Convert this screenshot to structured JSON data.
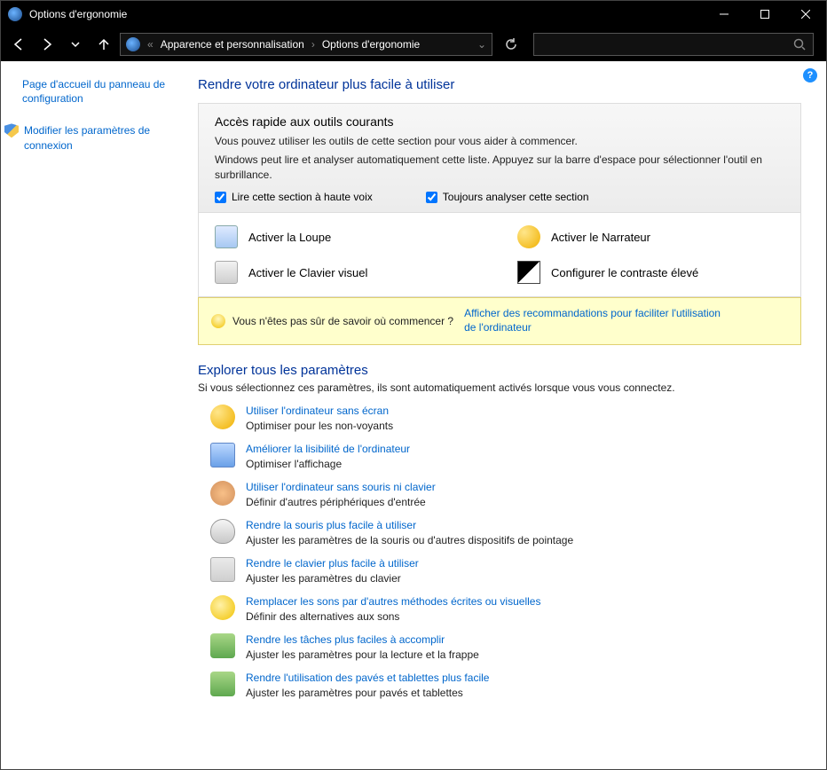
{
  "window": {
    "title": "Options d'ergonomie"
  },
  "breadcrumb": {
    "level1": "Apparence et personnalisation",
    "level2": "Options d'ergonomie"
  },
  "sidebar": {
    "home_link": "Page d'accueil du panneau de configuration",
    "uac_link": "Modifier les paramètres de connexion"
  },
  "main": {
    "header": "Rendre votre ordinateur plus facile à utiliser",
    "quick": {
      "title": "Accès rapide aux outils courants",
      "line1": "Vous pouvez utiliser les outils de cette section pour vous aider à commencer.",
      "line2": "Windows peut lire et analyser automatiquement cette liste. Appuyez sur la barre d'espace pour sélectionner l'outil en surbrillance.",
      "check1": "Lire cette section à haute voix",
      "check2": "Toujours analyser cette section",
      "tools": {
        "magnifier": "Activer la Loupe",
        "narrator": "Activer le Narrateur",
        "osk": "Activer le Clavier visuel",
        "contrast": "Configurer le contraste élevé"
      }
    },
    "tip": {
      "question": "Vous n'êtes pas sûr de savoir où commencer ?",
      "link": "Afficher des recommandations pour faciliter l'utilisation de l'ordinateur"
    },
    "explore": {
      "title": "Explorer tous les paramètres",
      "desc": "Si vous sélectionnez ces paramètres, ils sont automatiquement activés lorsque vous vous connectez.",
      "items": [
        {
          "link": "Utiliser l'ordinateur sans écran",
          "desc": "Optimiser pour les non-voyants",
          "icon": "ic-narr"
        },
        {
          "link": "Améliorer la lisibilité de l'ordinateur",
          "desc": "Optimiser l'affichage",
          "icon": "ic-monitor"
        },
        {
          "link": "Utiliser l'ordinateur sans souris ni clavier",
          "desc": "Définir d'autres périphériques d'entrée",
          "icon": "ic-head"
        },
        {
          "link": "Rendre la souris plus facile à utiliser",
          "desc": "Ajuster les paramètres de la souris ou d'autres dispositifs de pointage",
          "icon": "ic-mouse"
        },
        {
          "link": "Rendre le clavier plus facile à utiliser",
          "desc": "Ajuster les paramètres du clavier",
          "icon": "ic-keyb"
        },
        {
          "link": "Remplacer les sons par d'autres méthodes écrites ou visuelles",
          "desc": "Définir des alternatives aux sons",
          "icon": "ic-bubble"
        },
        {
          "link": "Rendre les tâches plus faciles à accomplir",
          "desc": "Ajuster les paramètres pour la lecture et la frappe",
          "icon": "ic-people"
        },
        {
          "link": "Rendre l'utilisation des pavés et tablettes plus facile",
          "desc": "Ajuster les paramètres pour pavés et tablettes",
          "icon": "ic-tablet"
        }
      ]
    }
  }
}
